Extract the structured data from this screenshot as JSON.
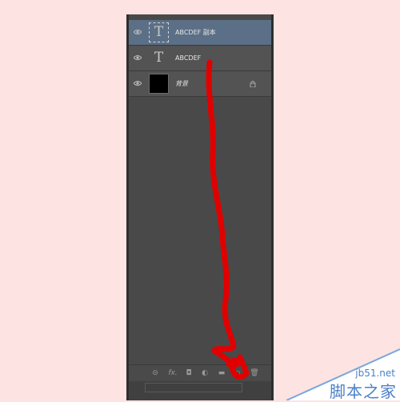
{
  "layers": [
    {
      "name": "ABCDEF 副本",
      "type": "text",
      "glyph": "T",
      "selected": true,
      "visible_icon": "eye-icon"
    },
    {
      "name": "ABCDEF",
      "type": "text",
      "glyph": "T",
      "selected": false,
      "visible_icon": "eye-icon"
    },
    {
      "name": "背景",
      "type": "fill",
      "fill_color": "#000000",
      "selected": false,
      "visible_icon": "eye-icon",
      "locked": true
    }
  ],
  "footer": {
    "buttons": [
      {
        "icon": "link-layers-icon",
        "glyph": "⊝"
      },
      {
        "icon": "fx-icon",
        "glyph": "fx."
      },
      {
        "icon": "add-mask-icon",
        "glyph": "◘"
      },
      {
        "icon": "adjustment-layer-icon",
        "glyph": "◐"
      },
      {
        "icon": "new-group-icon",
        "glyph": "▬"
      },
      {
        "icon": "new-layer-icon",
        "glyph": "▫"
      },
      {
        "icon": "delete-layer-icon",
        "glyph": "🗑"
      }
    ]
  },
  "watermark": {
    "url": "jb51.net",
    "site_name": "脚本之家"
  },
  "colors": {
    "background": "#fde3e1",
    "panel": "#494949",
    "selected_layer": "#5b6f86",
    "annotation": "#e10000"
  }
}
